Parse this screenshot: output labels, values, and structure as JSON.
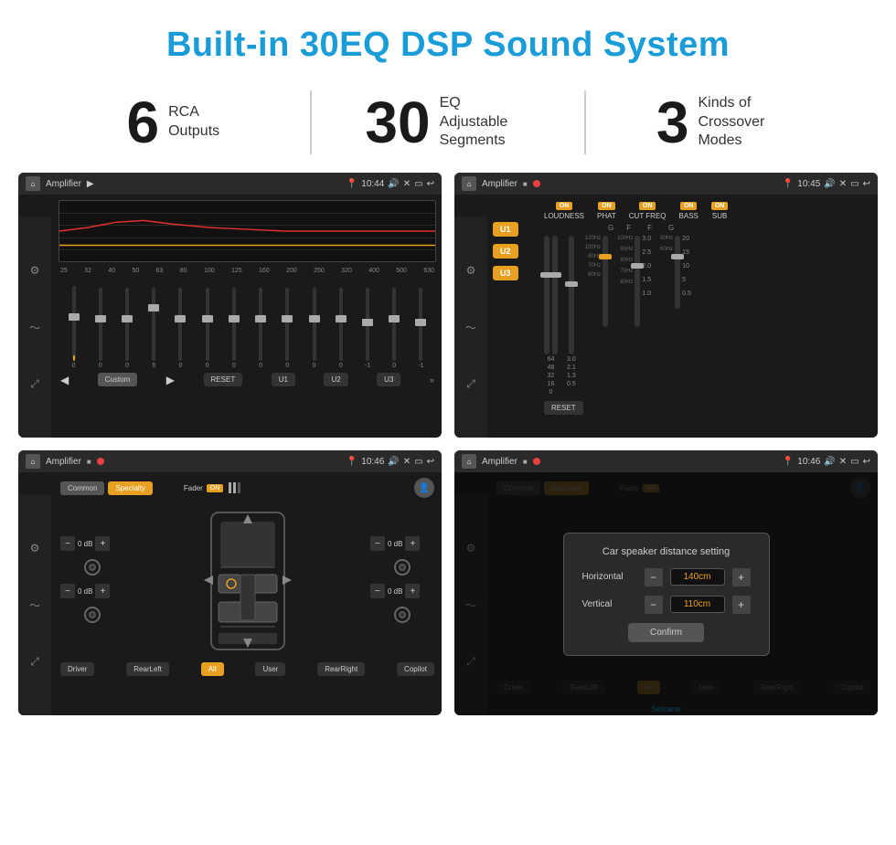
{
  "header": {
    "title": "Built-in 30EQ DSP Sound System"
  },
  "stats": [
    {
      "number": "6",
      "text": "RCA\nOutputs"
    },
    {
      "number": "30",
      "text": "EQ Adjustable\nSegments"
    },
    {
      "number": "3",
      "text": "Kinds of\nCrossover Modes"
    }
  ],
  "screens": {
    "eq": {
      "title": "Amplifier",
      "time": "10:44",
      "frequencies": [
        "25",
        "32",
        "40",
        "50",
        "63",
        "80",
        "100",
        "125",
        "160",
        "200",
        "250",
        "320",
        "400",
        "500",
        "630"
      ],
      "values": [
        "0",
        "0",
        "0",
        "5",
        "0",
        "0",
        "0",
        "0",
        "0",
        "0",
        "0",
        "-1",
        "0",
        "-1"
      ],
      "buttons": [
        "Custom",
        "RESET",
        "U1",
        "U2",
        "U3"
      ]
    },
    "amplifier": {
      "title": "Amplifier",
      "time": "10:45",
      "bands": [
        {
          "label": "LOUDNESS",
          "on": true
        },
        {
          "label": "PHAT",
          "on": true
        },
        {
          "label": "CUT FREQ",
          "on": true
        },
        {
          "label": "BASS",
          "on": true
        },
        {
          "label": "SUB",
          "on": true
        }
      ],
      "uButtons": [
        "U1",
        "U2",
        "U3"
      ],
      "resetLabel": "RESET"
    },
    "speaker": {
      "title": "Amplifier",
      "time": "10:46",
      "tabs": [
        "Common",
        "Specialty"
      ],
      "faderLabel": "Fader",
      "faderOn": "ON",
      "dbValues": [
        "0 dB",
        "0 dB",
        "0 dB",
        "0 dB"
      ],
      "zones": [
        "Driver",
        "RearLeft",
        "All",
        "User",
        "RearRight",
        "Copilot"
      ]
    },
    "distance": {
      "title": "Amplifier",
      "time": "10:46",
      "dialog": {
        "title": "Car speaker distance setting",
        "horizontal": {
          "label": "Horizontal",
          "value": "140cm"
        },
        "vertical": {
          "label": "Vertical",
          "value": "110cm"
        },
        "confirmLabel": "Confirm"
      },
      "zones": [
        "Driver",
        "RearLeft",
        "All",
        "User",
        "RearRight",
        "Copilot"
      ]
    }
  }
}
